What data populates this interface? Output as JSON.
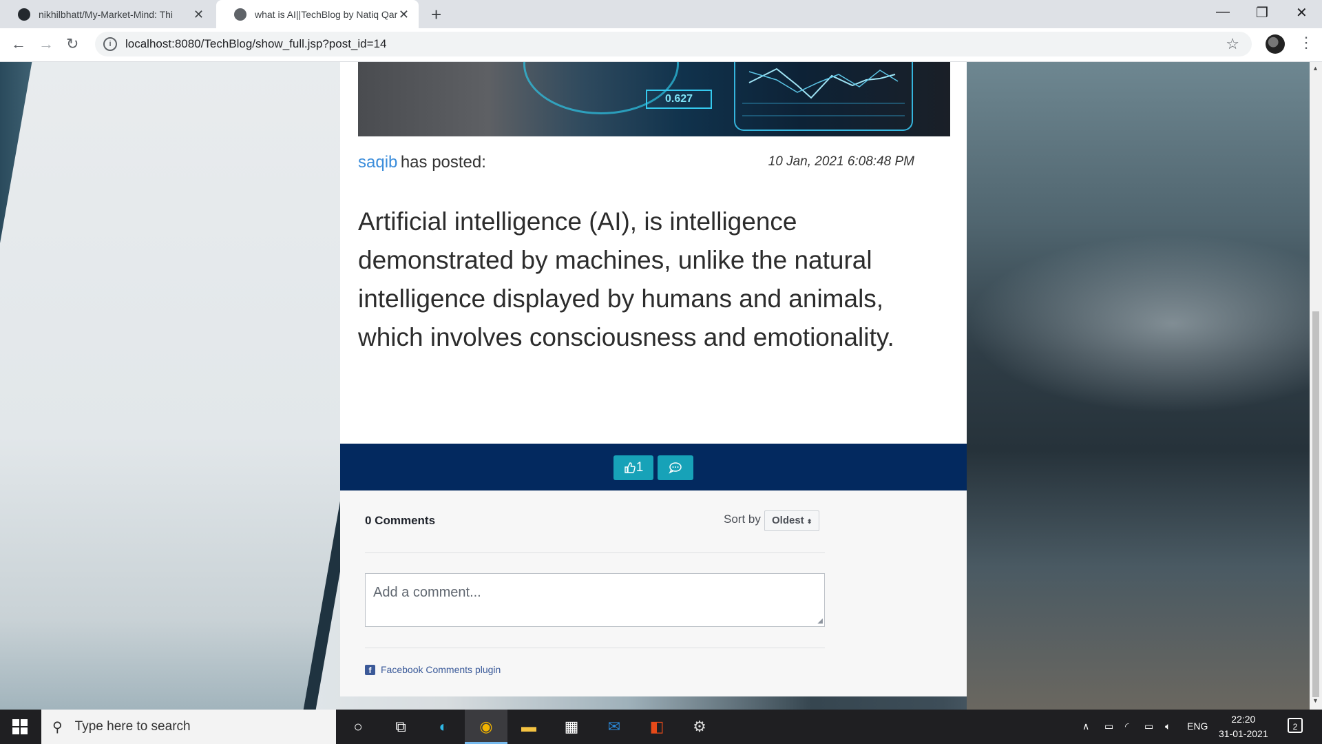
{
  "browser": {
    "tabs": [
      {
        "title": "nikhilbhatt/My-Market-Mind: Thi",
        "icon": "github-icon"
      },
      {
        "title": "what is AI||TechBlog by Natiq Qar",
        "icon": "globe-icon"
      }
    ],
    "new_tab": "+",
    "url": "localhost:8080/TechBlog/show_full.jsp?post_id=14"
  },
  "post": {
    "hero_value": "0.627",
    "author": "saqib",
    "posted_label": "has posted:",
    "date": "10 Jan, 2021 6:08:48 PM",
    "content": "Artificial intelligence (AI), is intelligence demonstrated by machines, unlike the natural intelligence displayed by humans and animals, which involves consciousness and emotionality.",
    "like_count": "1"
  },
  "comments": {
    "count_label": "0 Comments",
    "sort_label": "Sort by",
    "sort_value": "Oldest",
    "placeholder": "Add a comment...",
    "plugin_label": "Facebook Comments plugin"
  },
  "taskbar": {
    "search_placeholder": "Type here to search",
    "language": "ENG",
    "time": "22:20",
    "date": "31-01-2021",
    "notification_count": "2"
  }
}
